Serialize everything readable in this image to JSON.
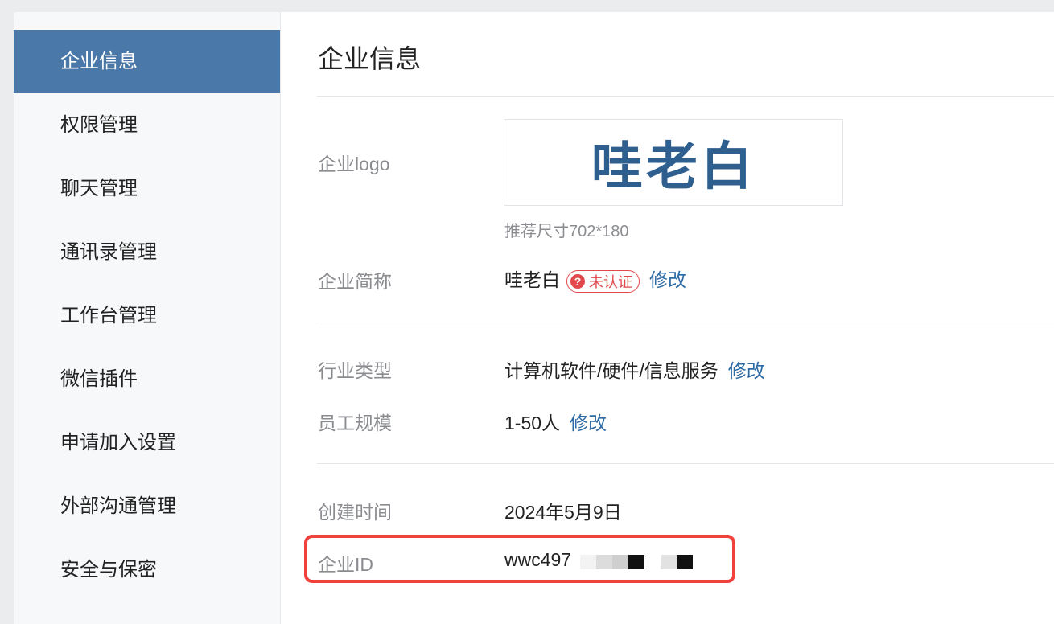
{
  "sidebar": {
    "items": [
      {
        "label": "企业信息"
      },
      {
        "label": "权限管理"
      },
      {
        "label": "聊天管理"
      },
      {
        "label": "通讯录管理"
      },
      {
        "label": "工作台管理"
      },
      {
        "label": "微信插件"
      },
      {
        "label": "申请加入设置"
      },
      {
        "label": "外部沟通管理"
      },
      {
        "label": "安全与保密"
      }
    ]
  },
  "main": {
    "title": "企业信息",
    "logo": {
      "label": "企业logo",
      "text": "哇老白",
      "hint": "推荐尺寸702*180"
    },
    "short_name": {
      "label": "企业简称",
      "value": "哇老白",
      "badge_icon": "?",
      "badge": "未认证",
      "edit": "修改"
    },
    "industry": {
      "label": "行业类型",
      "value": "计算机软件/硬件/信息服务",
      "edit": "修改"
    },
    "scale": {
      "label": "员工规模",
      "value": "1-50人",
      "edit": "修改"
    },
    "created": {
      "label": "创建时间",
      "value": "2024年5月9日"
    },
    "corp_id": {
      "label": "企业ID",
      "value": "wwc497"
    }
  },
  "colors": {
    "sidebar_active": "#4a78a8",
    "link": "#2b6aa3",
    "badge": "#e0484b",
    "highlight_border": "#f0413d",
    "logo_text": "#2f5f8e"
  },
  "icons": {
    "badge_icon": "question-circle-icon"
  }
}
